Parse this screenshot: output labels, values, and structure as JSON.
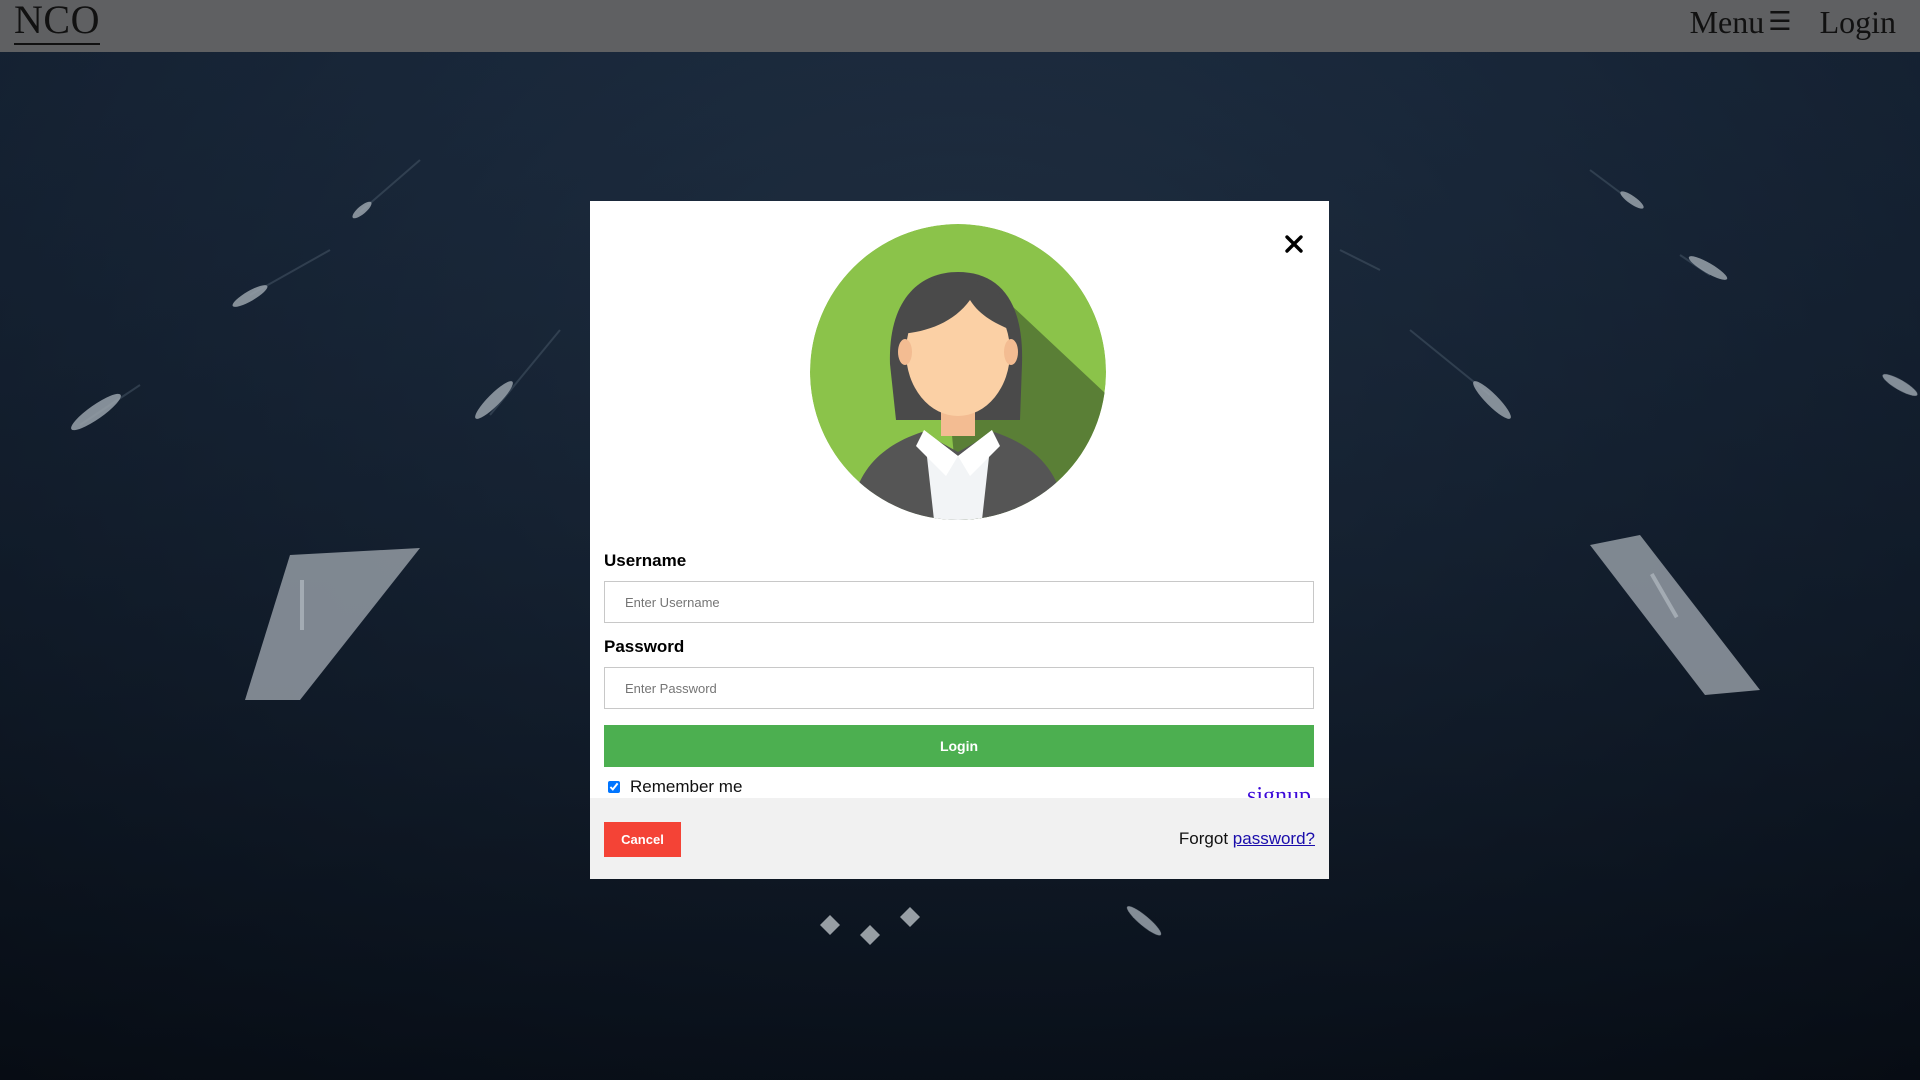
{
  "header": {
    "brand": "NCO",
    "menu_label": "Menu",
    "menu_icon": "hamburger-icon",
    "login_label": "Login"
  },
  "login_modal": {
    "close_icon": "close-icon",
    "avatar_icon": "female-user-avatar",
    "username_label": "Username",
    "username_placeholder": "Enter Username",
    "username_value": "",
    "password_label": "Password",
    "password_placeholder": "Enter Password",
    "password_value": "",
    "login_button": "Login",
    "remember_label": "Remember me",
    "remember_checked": true,
    "signup_link": "signup",
    "cancel_button": "Cancel",
    "forgot_prefix": "Forgot",
    "forgot_link": "password?"
  },
  "colors": {
    "topbar": "#5f6062",
    "login_button": "#4caf50",
    "cancel_button": "#f44336",
    "signup_link": "#3c0ad9",
    "footer": "#f1f1f1"
  }
}
